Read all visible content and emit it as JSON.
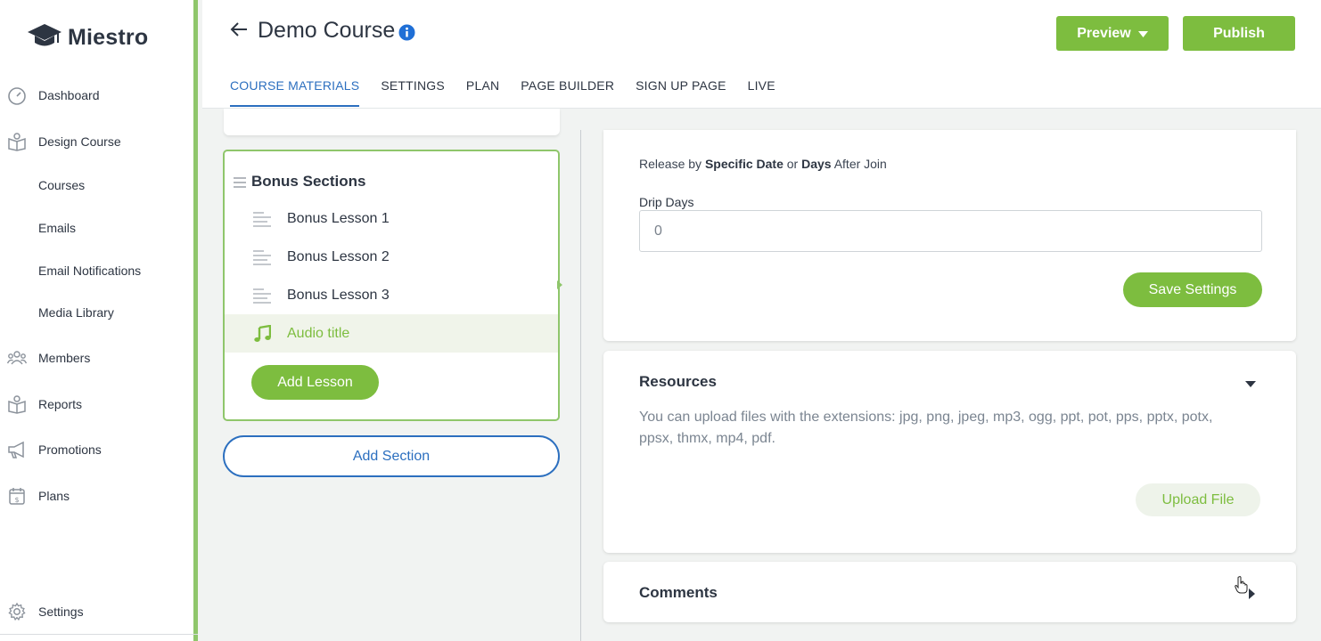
{
  "app": {
    "name": "Miestro"
  },
  "sidebar": {
    "items": [
      {
        "label": "Dashboard",
        "icon": "gauge-icon"
      },
      {
        "label": "Design Course",
        "icon": "book-icon"
      },
      {
        "label": "Courses"
      },
      {
        "label": "Emails"
      },
      {
        "label": "Email Notifications"
      },
      {
        "label": "Media Library"
      },
      {
        "label": "Members",
        "icon": "members-icon"
      },
      {
        "label": "Reports",
        "icon": "book-icon"
      },
      {
        "label": "Promotions",
        "icon": "megaphone-icon"
      },
      {
        "label": "Plans",
        "icon": "calendar-dollar-icon"
      },
      {
        "label": "Settings",
        "icon": "gear-icon"
      }
    ]
  },
  "header": {
    "title": "Demo Course",
    "preview_label": "Preview",
    "publish_label": "Publish",
    "tabs": [
      {
        "label": "COURSE MATERIALS",
        "active": true
      },
      {
        "label": "SETTINGS"
      },
      {
        "label": "PLAN"
      },
      {
        "label": "PAGE BUILDER"
      },
      {
        "label": "SIGN UP PAGE"
      },
      {
        "label": "LIVE"
      }
    ]
  },
  "section": {
    "title": "Bonus Sections",
    "lessons": [
      {
        "label": "Bonus Lesson 1",
        "icon": "text-lines-icon"
      },
      {
        "label": "Bonus Lesson 2",
        "icon": "text-lines-icon"
      },
      {
        "label": "Bonus Lesson 3",
        "icon": "text-lines-icon"
      },
      {
        "label": "Audio title",
        "icon": "music-note-icon",
        "active": true
      }
    ],
    "add_lesson_label": "Add Lesson",
    "add_section_label": "Add Section"
  },
  "settings_panel": {
    "release_prefix": "Release by ",
    "release_option1": "Specific Date",
    "release_mid": " or ",
    "release_option2": "Days",
    "release_suffix": " After Join",
    "drip_label": "Drip Days",
    "drip_value": "0",
    "save_label": "Save Settings"
  },
  "resources_panel": {
    "title": "Resources",
    "description": "You can upload files with the extensions: jpg, png, jpeg, mp3, ogg, ppt, pot, pps, pptx, potx, ppsx, thmx, mp4, pdf.",
    "upload_label": "Upload File"
  },
  "comments_panel": {
    "title": "Comments"
  },
  "colors": {
    "accent_green": "#7dbd3f",
    "accent_blue": "#2c6fbf",
    "sidebar_border": "#8fc66b"
  }
}
